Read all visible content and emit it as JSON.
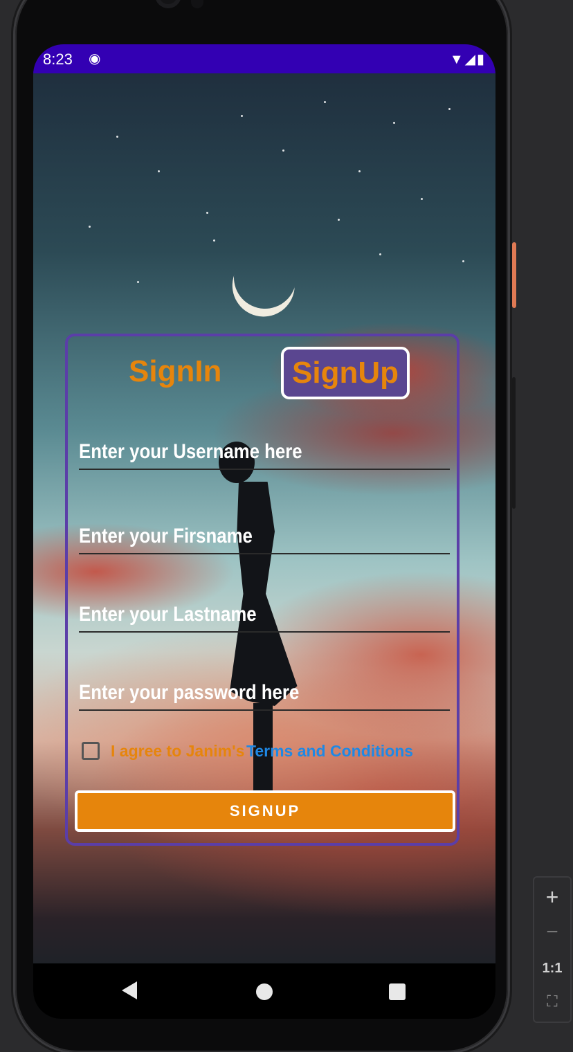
{
  "status_bar": {
    "time": "8:23",
    "sync_icon": "sync-icon",
    "icons": "▼◢▮"
  },
  "tabs": {
    "signin": "SignIn",
    "signup": "SignUp"
  },
  "fields": {
    "username_placeholder": "Enter your Username here",
    "firstname_placeholder": "Enter your Firsname",
    "lastname_placeholder": "Enter your Lastname",
    "password_placeholder": "Enter your password here"
  },
  "agreement": {
    "text": "I agree to Janim's",
    "link": "Terms and Conditions"
  },
  "signup_button": "SIGNUP",
  "zoom": {
    "in": "+",
    "out": "−",
    "one_to_one": "1:1",
    "fit": "⛶"
  },
  "colors": {
    "accent": "#e6850c",
    "card_border": "#5b3ea8",
    "status_bar": "#3300b3",
    "link": "#1e88e5"
  }
}
